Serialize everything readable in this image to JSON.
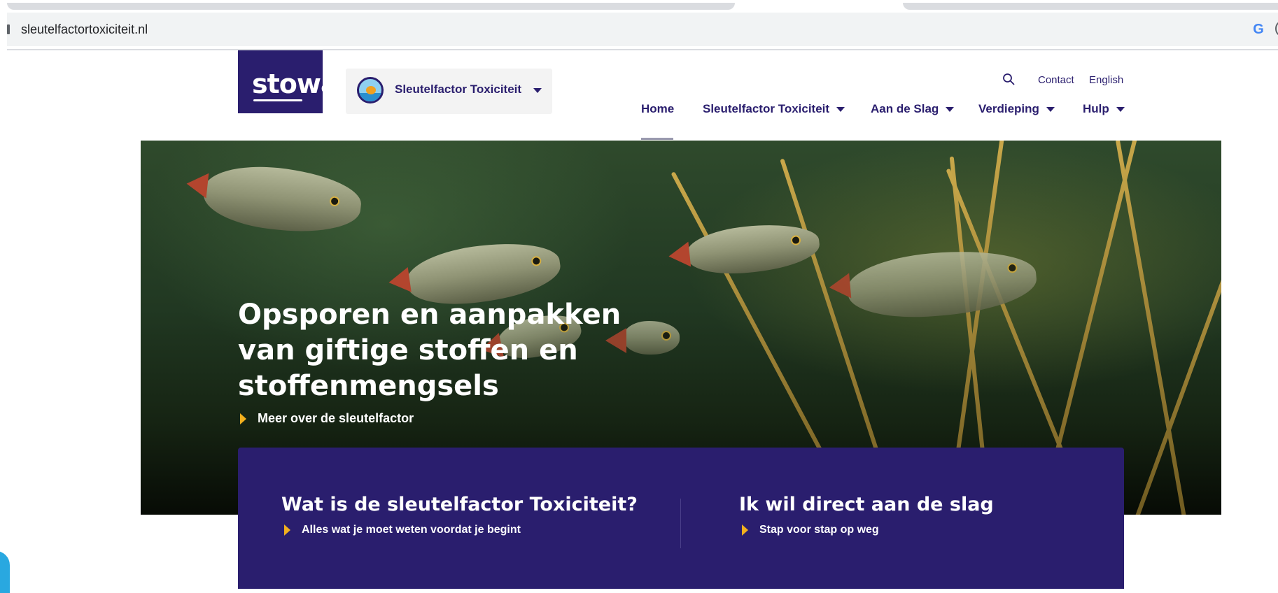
{
  "browser": {
    "url": "sleutelfactortoxiciteit.nl",
    "google_icon": "G"
  },
  "header": {
    "logo_text": "stowa",
    "site_switcher_label": "Sleutelfactor Toxiciteit",
    "utility": {
      "contact": "Contact",
      "english": "English"
    },
    "nav": [
      {
        "label": "Home",
        "active": true
      },
      {
        "label": "Sleutelfactor Toxiciteit"
      },
      {
        "label": "Aan de Slag"
      },
      {
        "label": "Verdieping"
      },
      {
        "label": "Hulp"
      }
    ]
  },
  "hero": {
    "title": "Opsporen en aanpakken van giftige stoffen en stoffenmengsels",
    "link": "Meer over de sleutelfactor"
  },
  "panel": {
    "left": {
      "heading": "Wat is de sleutelfactor Toxiciteit?",
      "link": "Alles wat je moet weten voordat je begint"
    },
    "right": {
      "heading": "Ik wil direct aan de slag",
      "link": "Stap voor stap op weg"
    }
  },
  "colors": {
    "brand_purple": "#2a1e6e",
    "accent_yellow": "#f2b01e"
  },
  "icons": [
    "search-icon",
    "chevron-down-icon",
    "arrow-right-icon",
    "google-icon"
  ]
}
